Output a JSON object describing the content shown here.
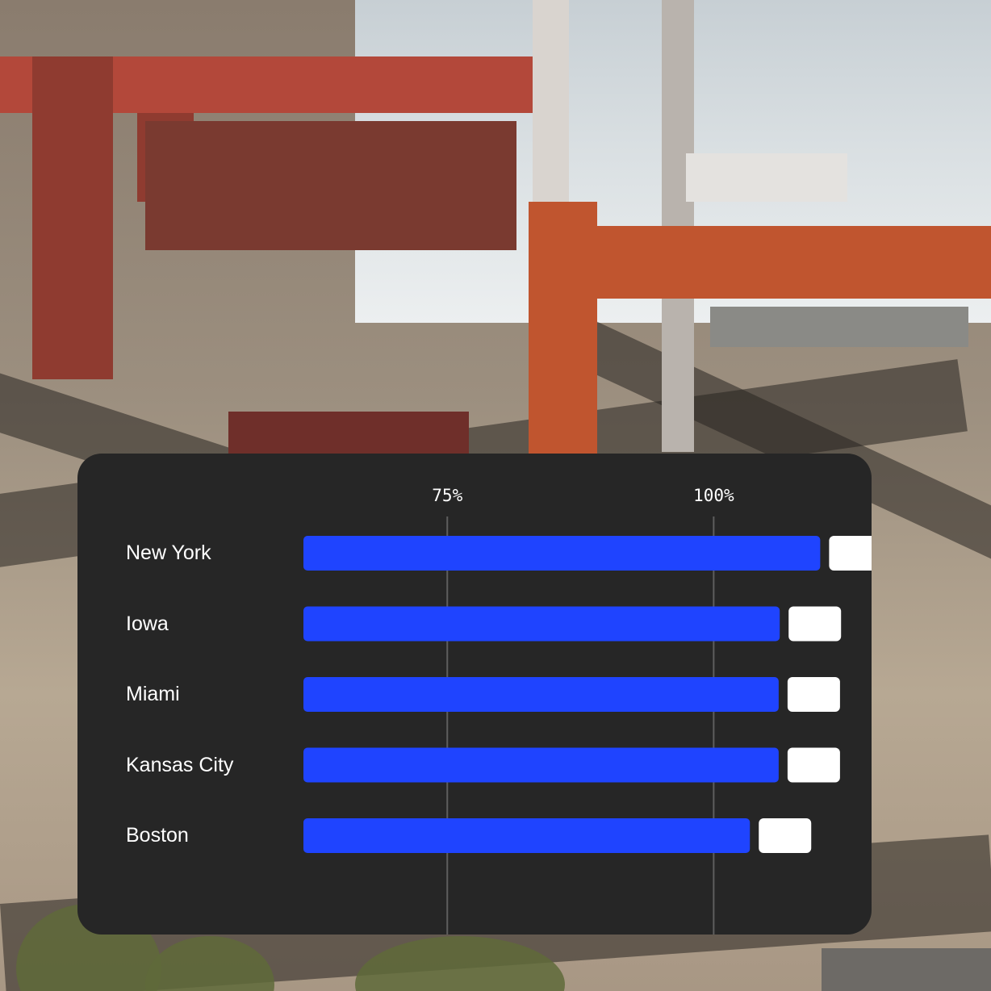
{
  "chart_data": {
    "type": "bar",
    "orientation": "horizontal",
    "categories": [
      "New York",
      "Iowa",
      "Miami",
      "Kansas City",
      "Boston"
    ],
    "values": [
      110.0,
      106.2,
      106.1,
      106.1,
      103.4
    ],
    "tick_labels": [
      "75%",
      "100%"
    ],
    "ticks": [
      75,
      100
    ],
    "xlim": [
      61.5,
      113
    ],
    "grid": "vertical lines at ticks",
    "bar_color": "#1f44ff",
    "end_marker_color": "#ffffff",
    "card_color": "#262626",
    "label_color": "#ffffff"
  }
}
